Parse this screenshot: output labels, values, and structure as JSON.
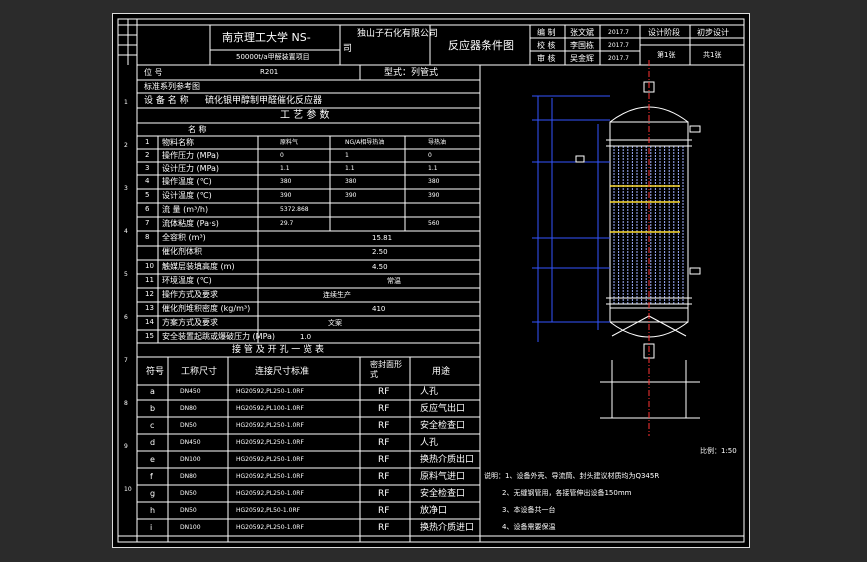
{
  "title_block": {
    "school": "南京理工大学 NS-",
    "company": "独山子石化有限公司",
    "company_cont": "司",
    "project": "50000t/a甲醛装置项目",
    "drawing_title": "反应器条件图",
    "roles": [
      {
        "role": "编  制",
        "name": "张文斌",
        "date": "2017.7"
      },
      {
        "role": "校  核",
        "name": "李国栋",
        "date": "2017.7"
      },
      {
        "role": "审  核",
        "name": "吴金辉",
        "date": "2017.7"
      }
    ],
    "stage_label": "设计阶段",
    "stage_value": "初步设计",
    "sheet_label": "第1张",
    "sheet_total": "共1张"
  },
  "header_rows": {
    "position_label": "位  号",
    "position_value": "R201",
    "type_label": "型式：列管式",
    "standard_label": "标准系列参考图",
    "device_label": "设 备 名 称",
    "device_value": "硫化银甲醇制甲醛催化反应器"
  },
  "process_params": {
    "section_title": "工  艺  参  数",
    "name_header": "名        称",
    "columns": [
      "原料气",
      "NG/A相导热油",
      "导热油"
    ],
    "rows": [
      {
        "no": "1",
        "name": "物料名称",
        "v": [
          "原料气",
          "NG/A相导热油",
          "导热油"
        ]
      },
      {
        "no": "2",
        "name": "操作压力 (MPa)",
        "v": [
          "0",
          "1",
          "0"
        ]
      },
      {
        "no": "3",
        "name": "设计压力 (MPa)",
        "v": [
          "1.1",
          "1.1",
          "1.1"
        ]
      },
      {
        "no": "4",
        "name": "操作温度 (℃)",
        "v": [
          "380",
          "380",
          "380"
        ]
      },
      {
        "no": "5",
        "name": "设计温度 (℃)",
        "v": [
          "390",
          "390",
          "390"
        ]
      },
      {
        "no": "6",
        "name": "流 量 (m³/h)",
        "v": [
          "5372.868",
          "",
          ""
        ]
      },
      {
        "no": "7",
        "name": "流体粘度 (Pa·s)",
        "v": [
          "29.7",
          "",
          "560"
        ]
      }
    ],
    "merged_rows": [
      {
        "no": "8",
        "name": "全容积 (m³)",
        "value": "15.81"
      },
      {
        "no": "",
        "name": "催化剂体积",
        "value": "2.50"
      },
      {
        "no": "10",
        "name": "触媒层装填高度 (m)",
        "value": "4.50"
      },
      {
        "no": "11",
        "name": "环境温度 (℃)",
        "value": "常温"
      },
      {
        "no": "12",
        "name": "操作方式及要求",
        "value": "连续生产"
      },
      {
        "no": "13",
        "name": "催化剂堆积密度 (kg/m³)",
        "value": "410"
      },
      {
        "no": "14",
        "name": "方案方式及要求",
        "value": "文案"
      },
      {
        "no": "15",
        "name": "安全装置起跳或爆破压力 (MPa)",
        "value": "1.0"
      }
    ]
  },
  "nozzles": {
    "section_title": "接  管  及  开  孔  一  览  表",
    "headers": {
      "mark": "符号",
      "size": "工称尺寸",
      "standard": "连接尺寸标准",
      "seal": "密封面形式",
      "use": "用途"
    },
    "rows": [
      {
        "mark": "a",
        "size": "DN450",
        "standard": "HG20592,PL250-1.0RF",
        "seal": "RF",
        "use": "人孔"
      },
      {
        "mark": "b",
        "size": "DN80",
        "standard": "HG20592,PL100-1.0RF",
        "seal": "RF",
        "use": "反应气出口"
      },
      {
        "mark": "c",
        "size": "DN50",
        "standard": "HG20592,PL250-1.0RF",
        "seal": "RF",
        "use": "安全检查口"
      },
      {
        "mark": "d",
        "size": "DN450",
        "standard": "HG20592,PL250-1.0RF",
        "seal": "RF",
        "use": "人孔"
      },
      {
        "mark": "e",
        "size": "DN100",
        "standard": "HG20592,PL250-1.0RF",
        "seal": "RF",
        "use": "换热介质出口"
      },
      {
        "mark": "f",
        "size": "DN80",
        "standard": "HG20592,PL250-1.0RF",
        "seal": "RF",
        "use": "原料气进口"
      },
      {
        "mark": "g",
        "size": "DN50",
        "standard": "HG20592,PL250-1.0RF",
        "seal": "RF",
        "use": "安全检查口"
      },
      {
        "mark": "h",
        "size": "DN50",
        "standard": "HG20592,PL50-1.0RF",
        "seal": "RF",
        "use": "放净口"
      },
      {
        "mark": "i",
        "size": "DN100",
        "standard": "HG20592,PL250-1.0RF",
        "seal": "RF",
        "use": "换热介质进口"
      }
    ]
  },
  "notes": [
    "说明：1、设备外壳、导流筒、封头建议材质均为Q345R",
    "2、无缝钢管用，各接管伸出设备150mm",
    "3、本设备共一台",
    "4、设备需要保温"
  ],
  "scale": "比例：1:50",
  "row_markers": [
    "1",
    "2",
    "3",
    "4",
    "5",
    "6",
    "7",
    "8",
    "9",
    "10"
  ],
  "colors": {
    "frame": "#ffffff",
    "text_yellow": "#ffff66",
    "drawing_blue": "#3355ff",
    "drawing_red": "#ff3333",
    "drawing_yellow": "#ffdd33",
    "background": "#2b2b2b"
  }
}
